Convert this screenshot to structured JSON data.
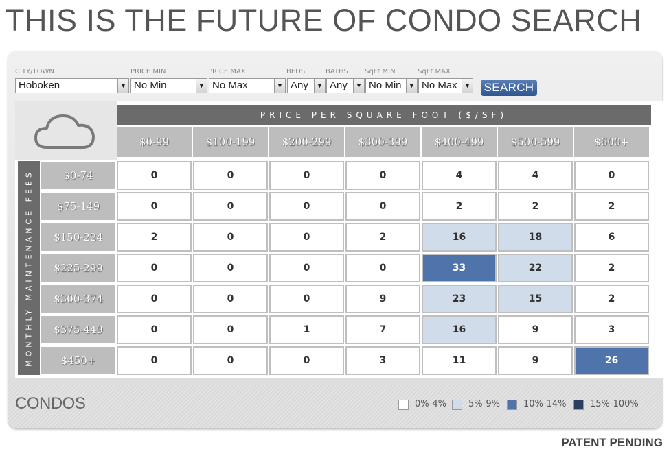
{
  "headline": "THIS IS THE FUTURE OF CONDO SEARCH",
  "filters": {
    "city": {
      "label": "CITY/TOWN",
      "value": "Hoboken"
    },
    "price_min": {
      "label": "PRICE MIN",
      "value": "No Min"
    },
    "price_max": {
      "label": "PRICE MAX",
      "value": "No Max"
    },
    "beds": {
      "label": "BEDS",
      "value": "Any"
    },
    "baths": {
      "label": "BATHS",
      "value": "Any"
    },
    "sqft_min": {
      "label": "SqFt MIN",
      "value": "No Min"
    },
    "sqft_max": {
      "label": "SqFt MAX",
      "value": "No Max"
    },
    "search_label": "SEARCH"
  },
  "grid": {
    "weather_icon": "cloud-icon",
    "column_title": "PRICE PER SQUARE FOOT ($/SF)",
    "row_title": "MONTHLY MAINTENANCE FEES",
    "columns": [
      "$0-99",
      "$100-199",
      "$200-299",
      "$300-399",
      "$400-499",
      "$500-599",
      "$600+"
    ],
    "rows": [
      {
        "label": "$0-74",
        "values": [
          "0",
          "0",
          "0",
          "0",
          "4",
          "4",
          "0"
        ],
        "bands": [
          0,
          0,
          0,
          0,
          0,
          0,
          0
        ]
      },
      {
        "label": "$75-149",
        "values": [
          "0",
          "0",
          "0",
          "0",
          "2",
          "2",
          "2"
        ],
        "bands": [
          0,
          0,
          0,
          0,
          0,
          0,
          0
        ]
      },
      {
        "label": "$150-224",
        "values": [
          "2",
          "0",
          "0",
          "2",
          "16",
          "18",
          "6"
        ],
        "bands": [
          0,
          0,
          0,
          0,
          1,
          1,
          0
        ]
      },
      {
        "label": "$225-299",
        "values": [
          "0",
          "0",
          "0",
          "0",
          "33",
          "22",
          "2"
        ],
        "bands": [
          0,
          0,
          0,
          0,
          2,
          1,
          0
        ]
      },
      {
        "label": "$300-374",
        "values": [
          "0",
          "0",
          "0",
          "9",
          "23",
          "15",
          "2"
        ],
        "bands": [
          0,
          0,
          0,
          0,
          1,
          1,
          0
        ]
      },
      {
        "label": "$375-449",
        "values": [
          "0",
          "0",
          "1",
          "7",
          "16",
          "9",
          "3"
        ],
        "bands": [
          0,
          0,
          0,
          0,
          1,
          0,
          0
        ]
      },
      {
        "label": "$450+",
        "values": [
          "0",
          "0",
          "0",
          "3",
          "11",
          "9",
          "26"
        ],
        "bands": [
          0,
          0,
          0,
          0,
          0,
          0,
          2
        ]
      }
    ]
  },
  "footer": {
    "category": "CONDOS",
    "legend": [
      {
        "label": "0%-4%",
        "color": "#ffffff"
      },
      {
        "label": "5%-9%",
        "color": "#d1dcea"
      },
      {
        "label": "10%-14%",
        "color": "#4f73ab"
      },
      {
        "label": "15%-100%",
        "color": "#2b3f5e"
      }
    ]
  },
  "patent": "PATENT PENDING"
}
